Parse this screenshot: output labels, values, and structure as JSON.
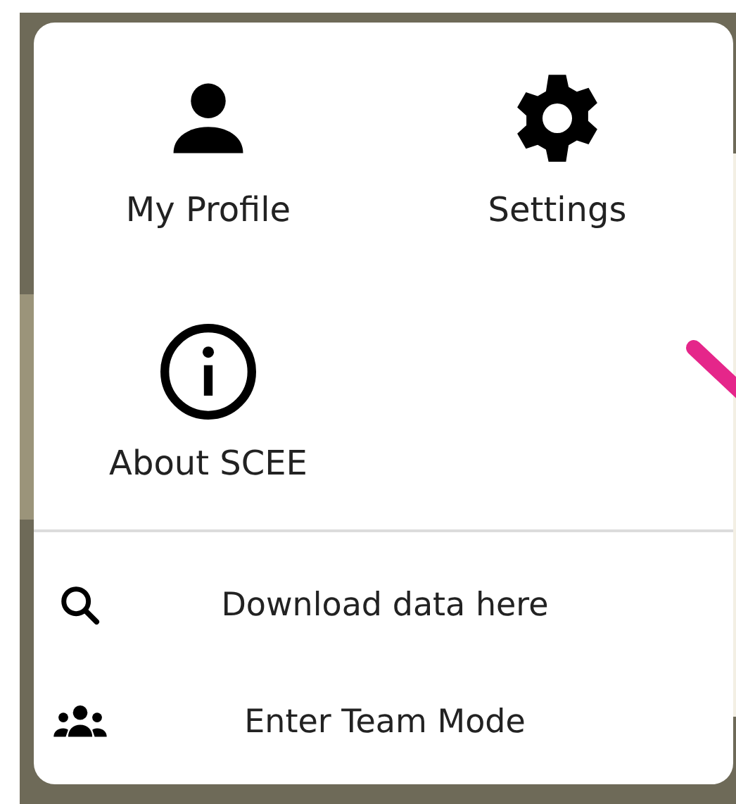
{
  "menu": {
    "tiles": [
      {
        "kind": "person",
        "label": "My Profile"
      },
      {
        "kind": "gear",
        "label": "Settings"
      },
      {
        "kind": "info",
        "label": "About SCEE"
      }
    ],
    "actions": [
      {
        "kind": "search",
        "label": "Download data here"
      },
      {
        "kind": "group",
        "label": "Enter Team Mode"
      }
    ]
  }
}
